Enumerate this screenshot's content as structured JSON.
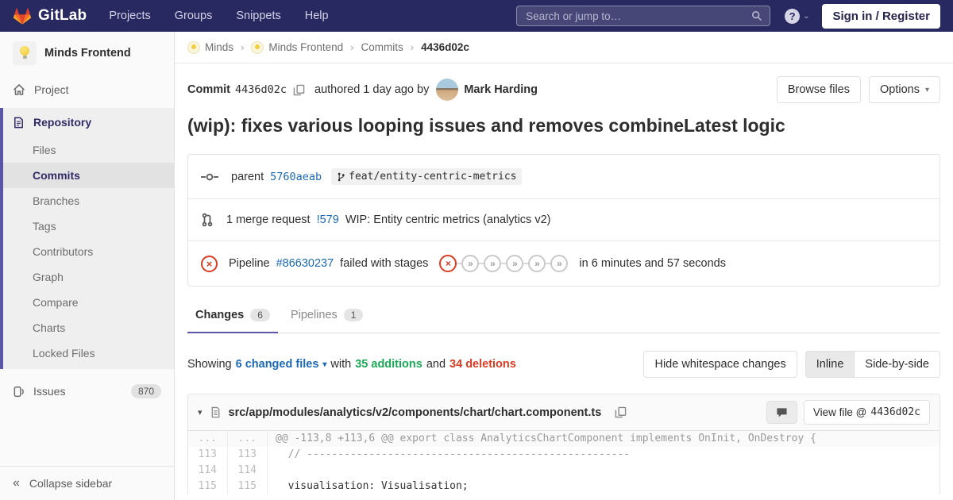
{
  "colors": {
    "navbar_bg": "#292961",
    "accent": "#5b55a7",
    "link": "#1b69b6",
    "green": "#1aaa55",
    "red": "#db3b21"
  },
  "icons": {
    "caret_down": "▾",
    "collapse_chevrons": "«",
    "skipped_chevrons": "»",
    "close_x": "×",
    "question_mark": "?",
    "breadcrumb_sep": "›"
  },
  "navbar": {
    "logo_text": "GitLab",
    "menu": [
      "Projects",
      "Groups",
      "Snippets",
      "Help"
    ],
    "search_placeholder": "Search or jump to…",
    "sign_in_label": "Sign in / Register"
  },
  "sidebar": {
    "project_name": "Minds Frontend",
    "project_label": "Project",
    "repository_label": "Repository",
    "repo_items": [
      "Files",
      "Commits",
      "Branches",
      "Tags",
      "Contributors",
      "Graph",
      "Compare",
      "Charts",
      "Locked Files"
    ],
    "issues_label": "Issues",
    "issues_count": "870",
    "collapse_label": "Collapse sidebar"
  },
  "breadcrumb": {
    "items": [
      "Minds",
      "Minds Frontend",
      "Commits",
      "4436d02c"
    ]
  },
  "commit": {
    "label": "Commit",
    "sha": "4436d02c",
    "authored_text": "authored 1 day ago by",
    "author": "Mark Harding",
    "browse_files_label": "Browse files",
    "options_label": "Options",
    "title": "(wip): fixes various looping issues and removes combineLatest logic"
  },
  "meta": {
    "parent_label": "parent",
    "parent_sha": "5760aeab",
    "branch": "feat/entity-centric-metrics",
    "mr_text": "1 merge request",
    "mr_ref": "!579",
    "mr_title": "WIP: Entity centric metrics (analytics v2)",
    "pipeline_label": "Pipeline",
    "pipeline_id": "#86630237",
    "pipeline_status": "failed with stages",
    "pipeline_duration": "in 6 minutes and 57 seconds"
  },
  "tabs": [
    {
      "label": "Changes",
      "count": "6"
    },
    {
      "label": "Pipelines",
      "count": "1"
    }
  ],
  "summary": {
    "showing": "Showing",
    "files_dropdown": "6 changed files",
    "with": "with",
    "additions": "35 additions",
    "and": "and",
    "deletions": "34 deletions",
    "hide_whitespace_label": "Hide whitespace changes",
    "inline_label": "Inline",
    "side_by_side_label": "Side-by-side"
  },
  "diff_file": {
    "path": "src/app/modules/analytics/v2/components/chart/chart.component.ts",
    "view_file_label": "View file @",
    "view_file_sha": "4436d02c",
    "hunk": {
      "old": "...",
      "new": "...",
      "text": "@@ -113,8 +113,6 @@ export class AnalyticsChartComponent implements OnInit, OnDestroy {"
    },
    "lines": [
      {
        "old": "113",
        "new": "113",
        "code": "  // ----------------------------------------------------"
      },
      {
        "old": "114",
        "new": "114",
        "code": ""
      },
      {
        "old": "115",
        "new": "115",
        "code": "  visualisation: Visualisation;"
      }
    ]
  }
}
